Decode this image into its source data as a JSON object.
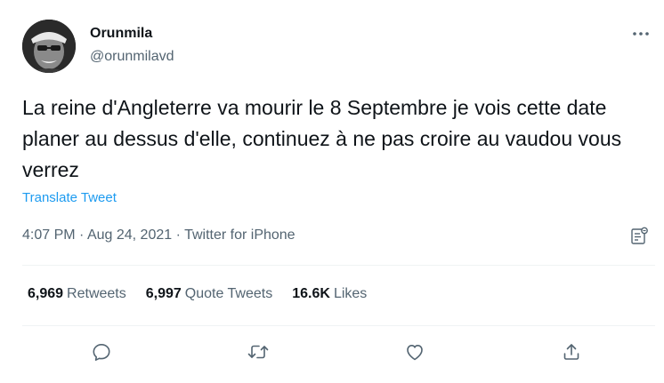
{
  "author": {
    "display_name": "Orunmila",
    "handle": "@orunmilavd"
  },
  "tweet": {
    "text": "La reine d'Angleterre va mourir le 8 Septembre je vois cette date planer au dessus d'elle, continuez à ne pas croire au vaudou vous verrez",
    "translate_label": "Translate Tweet",
    "time": "4:07 PM",
    "date": "Aug 24, 2021",
    "separator": " · ",
    "source": "Twitter for iPhone"
  },
  "stats": {
    "retweets_count": "6,969",
    "retweets_label": "Retweets",
    "quote_count": "6,997",
    "quote_label": "Quote Tweets",
    "likes_count": "16.6K",
    "likes_label": "Likes"
  },
  "icons": {
    "more": "more-horizontal-icon",
    "analytics": "analytics-icon",
    "reply": "reply-icon",
    "retweet": "retweet-icon",
    "like": "heart-icon",
    "share": "share-icon"
  },
  "colors": {
    "text": "#0f1419",
    "secondary": "#536471",
    "accent": "#1d9bf0",
    "divider": "#eff3f4"
  }
}
